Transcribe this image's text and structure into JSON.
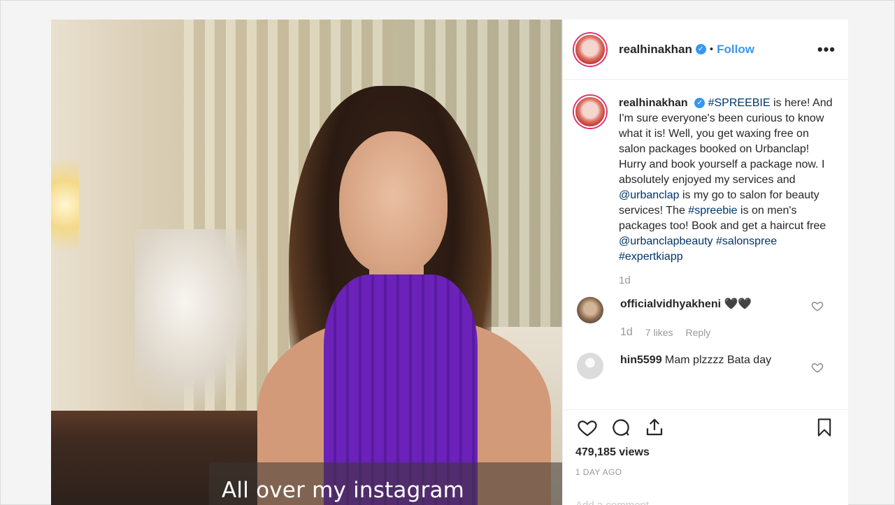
{
  "video": {
    "caption_text": "All over my instagram"
  },
  "post": {
    "username": "realhinakhan",
    "verified": true,
    "follow_label": "Follow",
    "dot": "•",
    "more_label": "•••"
  },
  "caption": {
    "username": "realhinakhan",
    "parts": [
      {
        "type": "tag",
        "text": "#SPREEBIE"
      },
      {
        "type": "text",
        "text": " is here! And I'm sure everyone's been curious to know what it is! Well, you get waxing free on salon packages booked on Urbanclap! Hurry and book yourself a package now. I absolutely enjoyed my services and "
      },
      {
        "type": "tag",
        "text": "@urbanclap"
      },
      {
        "type": "text",
        "text": " is my go to salon for beauty services! The "
      },
      {
        "type": "tag",
        "text": "#spreebie"
      },
      {
        "type": "text",
        "text": " is on men's packages too! Book and get a haircut free "
      },
      {
        "type": "tag",
        "text": "@urbanclapbeauty"
      },
      {
        "type": "text",
        "text": " "
      },
      {
        "type": "tag",
        "text": "#salonspree"
      },
      {
        "type": "text",
        "text": " "
      },
      {
        "type": "tag",
        "text": "#expertkiapp"
      }
    ],
    "time": "1d"
  },
  "comments": [
    {
      "username": "officialvidhyakheni",
      "text": "🖤🖤",
      "time": "1d",
      "likes": "7 likes",
      "reply": "Reply"
    },
    {
      "username": "hin5599",
      "text": "Mam plzzzz Bata day"
    }
  ],
  "actions": {
    "views": "479,185 views",
    "date": "1 DAY AGO",
    "add_comment_placeholder": "Add a comment..."
  },
  "colors": {
    "accent_blue": "#3897f0",
    "hashtag": "#003569",
    "dress_purple": "#6b22b8"
  },
  "icons": [
    "more-options-icon",
    "verified-badge-icon",
    "heart-icon",
    "comment-icon",
    "share-icon",
    "bookmark-icon"
  ]
}
